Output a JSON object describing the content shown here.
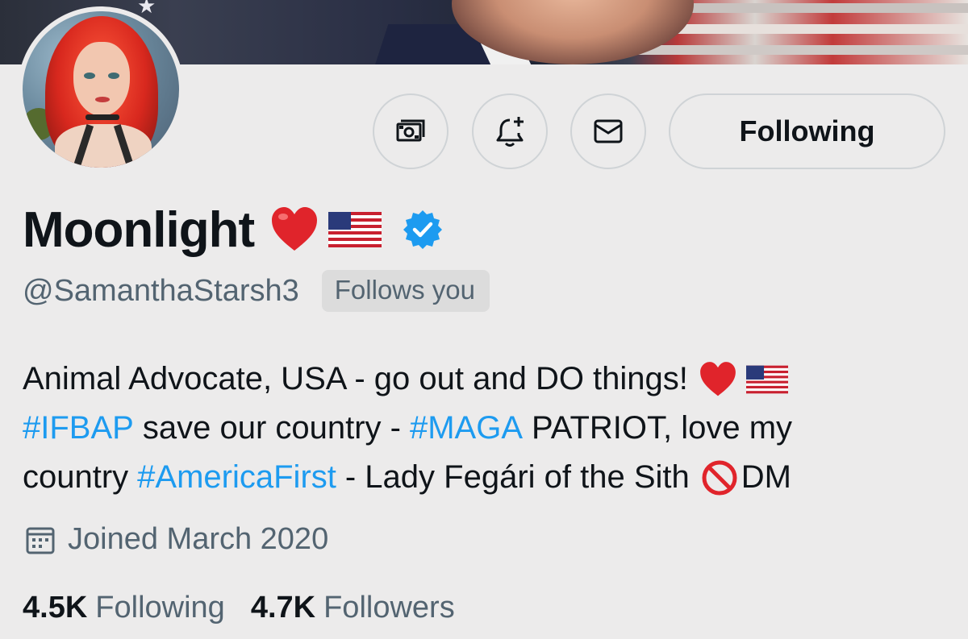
{
  "profile": {
    "display_name": "Moonlight",
    "name_emojis": [
      "red-heart",
      "us-flag"
    ],
    "verified": true,
    "handle": "@SamanthaStarsh3",
    "follows_you_badge": "Follows you",
    "bio": {
      "line1": "Animal Advocate, USA - go out and DO things!",
      "line2_hashtag1": "#IFBAP",
      "line2_text1": "save our country -",
      "line2_hashtag2": "#MAGA",
      "line2_text2": "PATRIOT, love my",
      "line3_text1": "country",
      "line3_hashtag": "#AmericaFirst",
      "line3_text2": "- Lady Fegári of the Sith",
      "line3_text3": "DM"
    },
    "joined": "Joined March 2020",
    "stats": {
      "following_count": "4.5K",
      "following_label": "Following",
      "followers_count": "4.7K",
      "followers_label": "Followers"
    }
  },
  "actions": {
    "follow_button_label": "Following",
    "icons": [
      "money-icon",
      "notification-bell-icon",
      "mail-icon"
    ]
  },
  "colors": {
    "background": "#ecebeb",
    "text_primary": "#0f1419",
    "text_secondary": "#536471",
    "hashtag": "#1d9bf0",
    "verified": "#1d9bf0",
    "badge_bg": "#dcdcdc",
    "button_border": "#cfd3d6"
  }
}
